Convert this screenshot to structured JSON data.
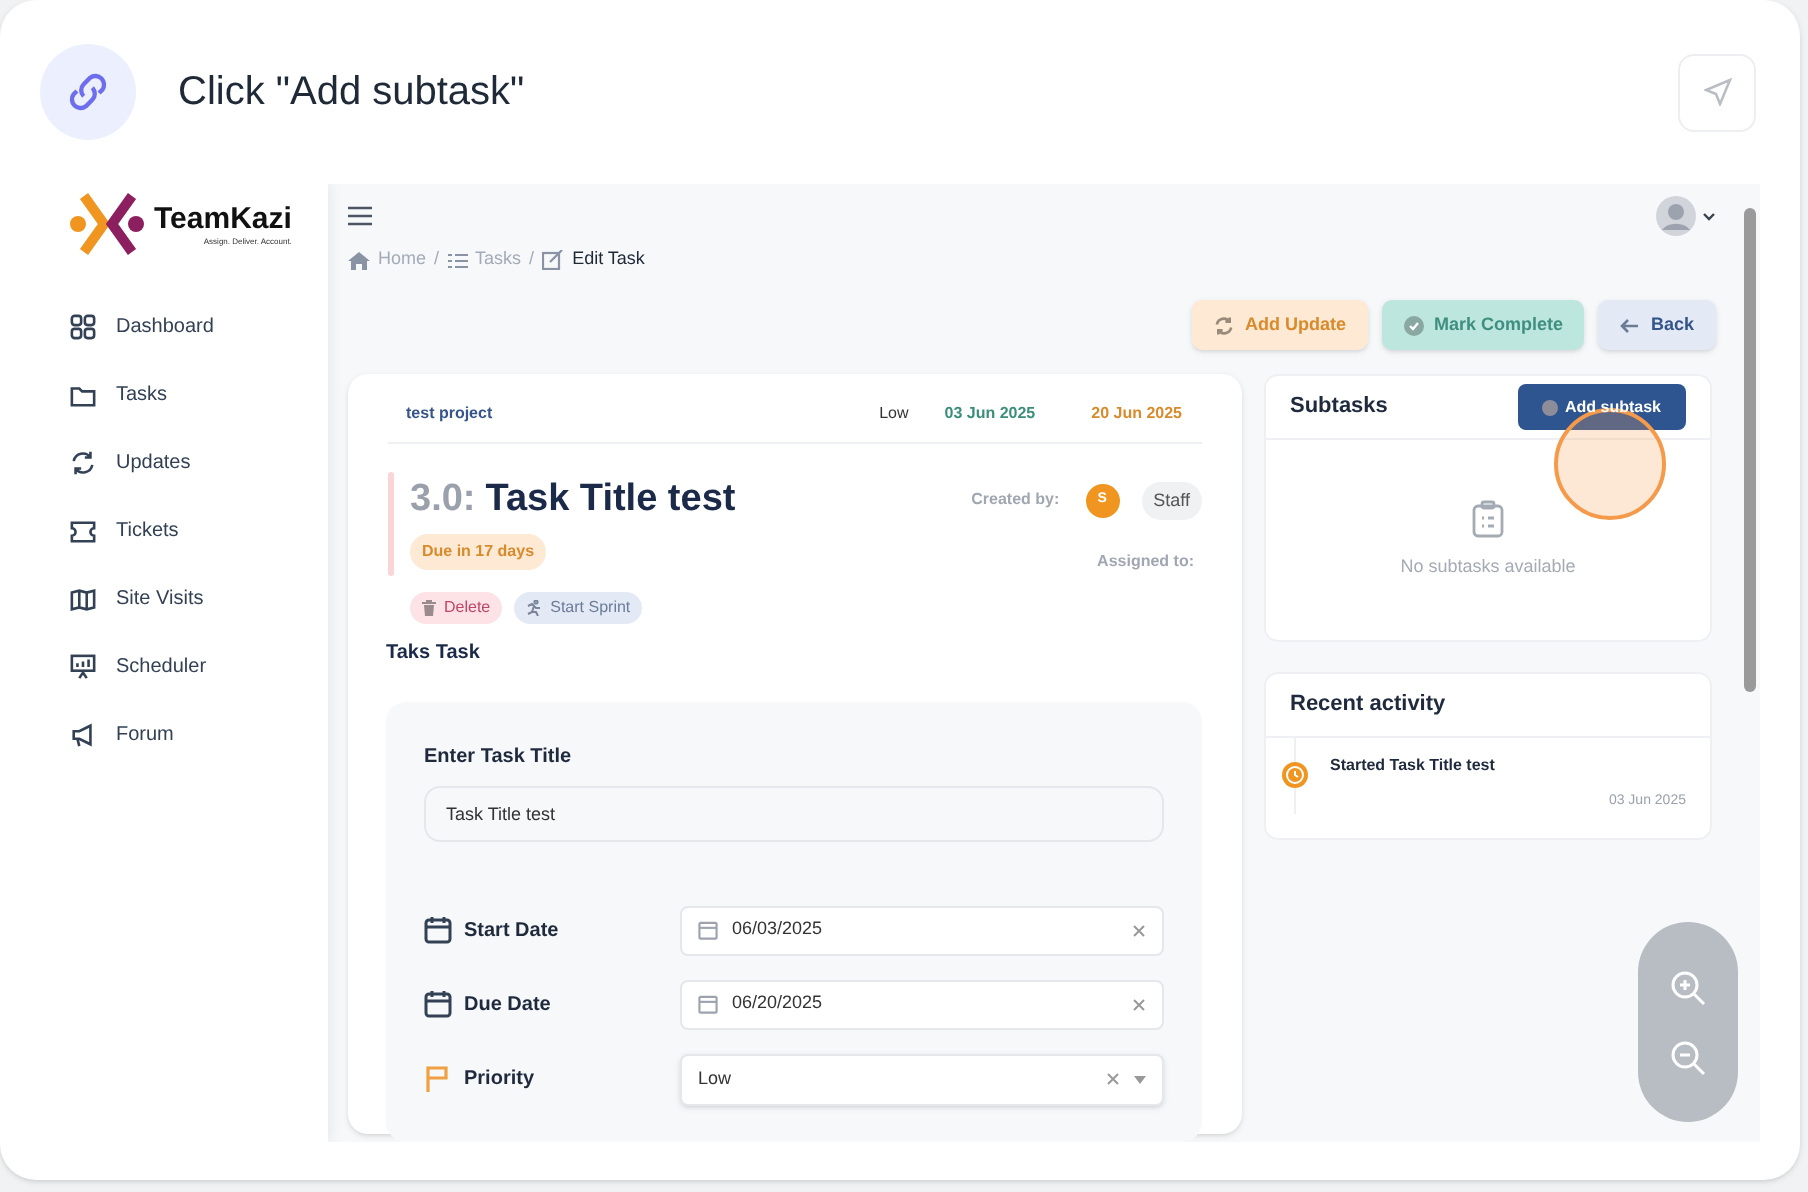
{
  "step": {
    "instruction": "Click \"Add subtask\""
  },
  "app": {
    "logo": {
      "name": "TeamKazi",
      "tagline": "Assign. Deliver. Account."
    },
    "sidebar": {
      "items": [
        {
          "label": "Dashboard"
        },
        {
          "label": "Tasks"
        },
        {
          "label": "Updates"
        },
        {
          "label": "Tickets"
        },
        {
          "label": "Site Visits"
        },
        {
          "label": "Scheduler"
        },
        {
          "label": "Forum"
        }
      ]
    },
    "breadcrumb": [
      {
        "label": "Home",
        "current": false,
        "separator": "/"
      },
      {
        "label": "Tasks",
        "current": false,
        "separator": "/"
      },
      {
        "label": "Edit Task",
        "current": true
      }
    ],
    "actions": [
      {
        "label": "Add Update",
        "kind": "update"
      },
      {
        "label": "Mark Complete",
        "kind": "complete"
      },
      {
        "label": "Back",
        "kind": "back"
      }
    ],
    "task": {
      "project": "test project",
      "priority": "Low",
      "start": "03 Jun 2025",
      "due": "20 Jun 2025",
      "number": "3.0:",
      "title": "Task Title test",
      "due_badge": "Due in 17 days",
      "created_by_label": "Created by:",
      "creator_initial": "S",
      "creator_role": "Staff",
      "assigned_label": "Assigned to:",
      "delete": "Delete",
      "start_sprint": "Start Sprint",
      "description": "Taks Task"
    },
    "form": {
      "title_label": "Enter Task Title",
      "title_value": "Task Title test",
      "rows": [
        {
          "label": "Start Date",
          "kind": "date",
          "value": "06/03/2025"
        },
        {
          "label": "Due Date",
          "kind": "date",
          "value": "06/20/2025"
        },
        {
          "label": "Priority",
          "kind": "select",
          "value": "Low"
        }
      ]
    },
    "subtasks": {
      "title": "Subtasks",
      "button": "Add subtask",
      "empty": "No subtasks available"
    },
    "activity": {
      "title": "Recent activity",
      "items": [
        {
          "text": "Started Task Title test",
          "date": "03 Jun 2025"
        }
      ]
    }
  }
}
